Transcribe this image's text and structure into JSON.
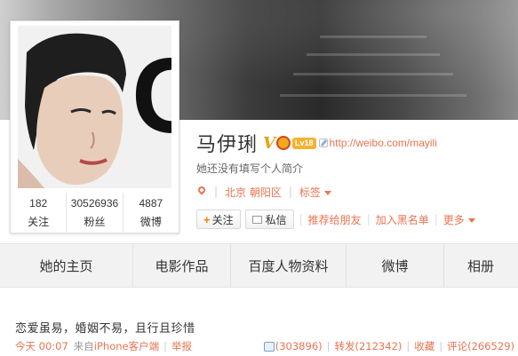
{
  "profile": {
    "name": "马伊琍",
    "verified_badge": "V",
    "level_badge": "Lv18",
    "url": "http://weibo.com/mayili",
    "bio": "她还没有填写个人简介",
    "location": "北京 朝阳区",
    "tags_label": "标签",
    "stats": [
      {
        "value": "182",
        "label": "关注"
      },
      {
        "value": "30526936",
        "label": "粉丝"
      },
      {
        "value": "4887",
        "label": "微博"
      }
    ],
    "avatar_letter": "C"
  },
  "actions": {
    "follow": "关注",
    "message": "私信",
    "recommend": "推荐给朋友",
    "blacklist": "加入黑名单",
    "more": "更多"
  },
  "tabs": [
    {
      "label": "她的主页"
    },
    {
      "label": "电影作品"
    },
    {
      "label": "百度人物资料"
    },
    {
      "label": "微博"
    },
    {
      "label": "相册"
    }
  ],
  "post": {
    "text": "恋爱虽易，婚姻不易，且行且珍惜",
    "time": "今天 00:07",
    "from_label": "来自",
    "source": "iPhone客户端",
    "report": "举报",
    "likes": "(303896)",
    "repost": "转发(212342)",
    "favorite": "收藏",
    "comment": "评论(266529)"
  },
  "colors": {
    "accent": "#eb7350",
    "tabbar_bg": "#f2f2f2",
    "gold": "#e9a10f"
  }
}
